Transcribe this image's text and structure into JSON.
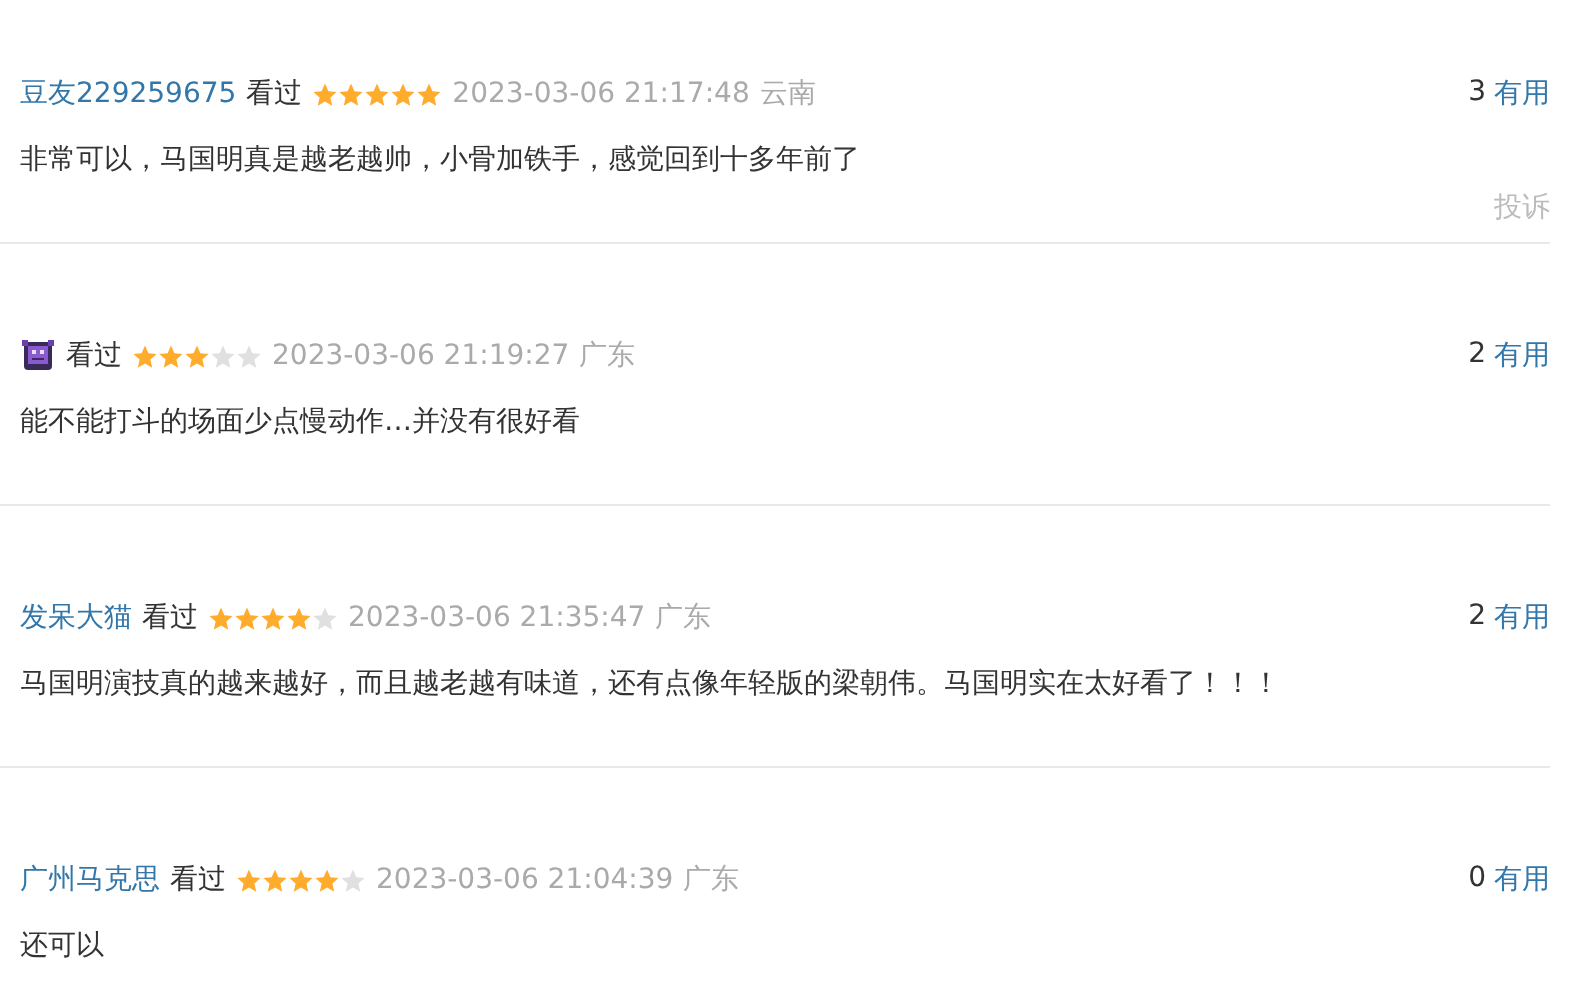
{
  "comments": [
    {
      "user": {
        "kind": "name",
        "name": "豆友229259675"
      },
      "status": "看过",
      "stars": 5,
      "time": "2023-03-06 21:17:48",
      "location": "云南",
      "votes": "3",
      "vote_label": "有用",
      "content": "非常可以，马国明真是越老越帅，小骨加铁手，感觉回到十多年前了",
      "report": "投诉"
    },
    {
      "user": {
        "kind": "avatar"
      },
      "status": "看过",
      "stars": 3,
      "time": "2023-03-06 21:19:27",
      "location": "广东",
      "votes": "2",
      "vote_label": "有用",
      "content": "能不能打斗的场面少点慢动作…并没有很好看"
    },
    {
      "user": {
        "kind": "name",
        "name": "发呆大猫"
      },
      "status": "看过",
      "stars": 4,
      "time": "2023-03-06 21:35:47",
      "location": "广东",
      "votes": "2",
      "vote_label": "有用",
      "content": "马国明演技真的越来越好，而且越老越有味道，还有点像年轻版的梁朝伟。马国明实在太好看了！！！"
    },
    {
      "user": {
        "kind": "name",
        "name": "广州马克思"
      },
      "status": "看过",
      "stars": 4,
      "time": "2023-03-06 21:04:39",
      "location": "广东",
      "votes": "0",
      "vote_label": "有用",
      "content": "还可以"
    }
  ]
}
